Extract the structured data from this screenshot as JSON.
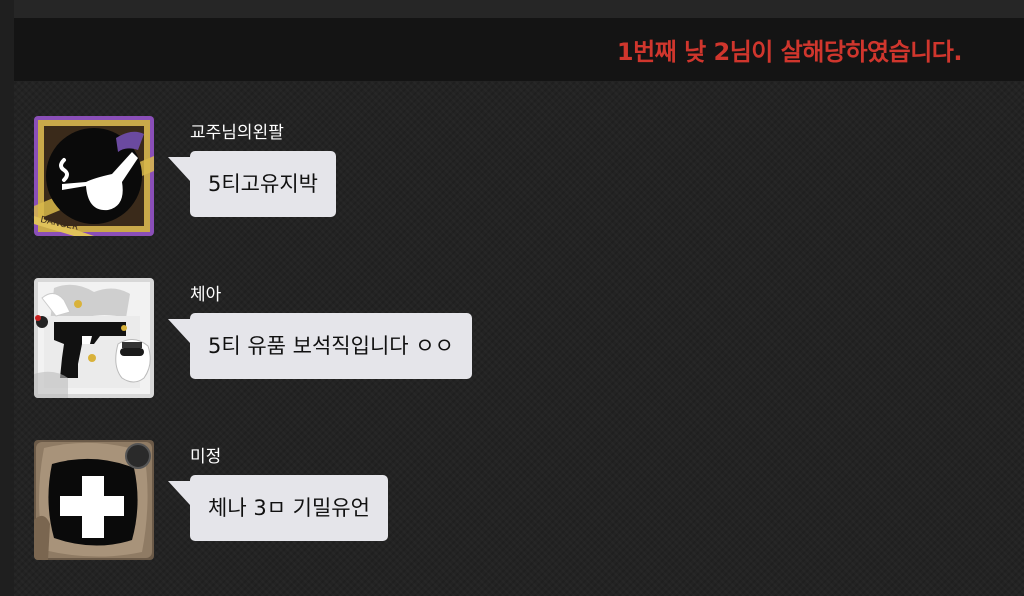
{
  "system_notice": {
    "text": "1번째 낮 2님이 살해당하였습니다.",
    "color": "#d0362d"
  },
  "messages": [
    {
      "username": "교주님의왼팔",
      "text": "5티고유지박",
      "avatar_icon": "pipe-icon"
    },
    {
      "username": "체아",
      "text": "5티 유품 보석직입니다 ㅇㅇ",
      "avatar_icon": "gun-ghost-icon"
    },
    {
      "username": "미정",
      "text": "체나 3ㅁ 기밀유언",
      "avatar_icon": "medical-cross-icon"
    }
  ],
  "colors": {
    "bubble": "#e5e5ea",
    "background": "#232323",
    "system_bar": "#141414"
  }
}
